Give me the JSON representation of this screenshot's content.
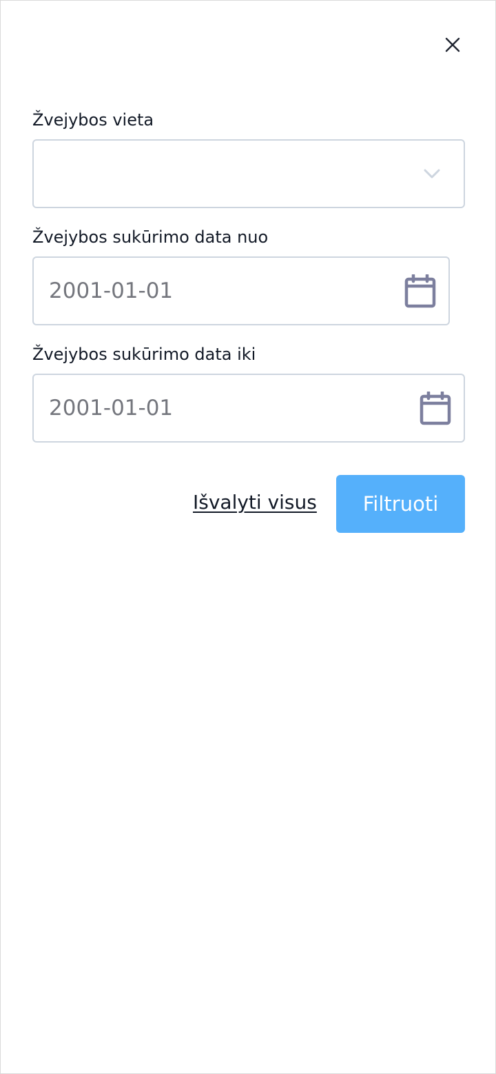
{
  "dialog": {
    "close_icon": "close-icon"
  },
  "fields": {
    "location": {
      "label": "Žvejybos vieta",
      "value": "",
      "icon": "chevron-down-icon"
    },
    "date_from": {
      "label": "Žvejybos sukūrimo data nuo",
      "placeholder": "2001-01-01",
      "icon": "calendar-icon"
    },
    "date_to": {
      "label": "Žvejybos sukūrimo data iki",
      "placeholder": "2001-01-01",
      "icon": "calendar-icon"
    }
  },
  "actions": {
    "clear_label": "Išvalyti visus",
    "filter_label": "Filtruoti"
  },
  "colors": {
    "primary": "#55b0fb",
    "border": "#cdd5df",
    "icon": "#7c7f9e",
    "placeholder": "#74767d",
    "text": "#121926"
  }
}
